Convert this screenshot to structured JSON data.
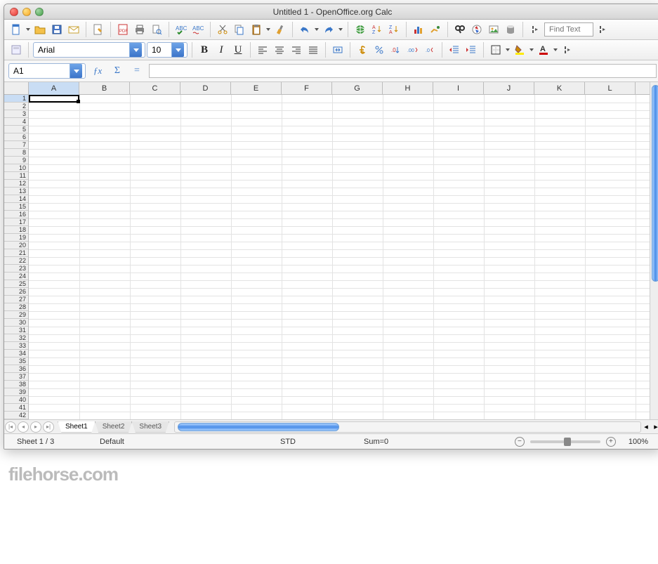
{
  "window": {
    "title": "Untitled 1 - OpenOffice.org Calc"
  },
  "toolbar1": {
    "icons": [
      "new-document",
      "open",
      "save",
      "mail",
      "edit-doc",
      "pdf-export",
      "print",
      "print-preview",
      "spellcheck",
      "auto-spellcheck",
      "cut",
      "copy",
      "paste",
      "format-paintbrush",
      "undo",
      "redo",
      "hyperlink",
      "sort-asc",
      "sort-desc",
      "insert-chart",
      "show-draw",
      "find-replace",
      "navigator",
      "gallery",
      "data-sources",
      "more"
    ],
    "find_placeholder": "Find Text"
  },
  "toolbar2": {
    "styles_icon": "styles",
    "font_name": "Arial",
    "font_size": "10",
    "bold": "B",
    "italic": "I",
    "underline": "U",
    "currency_icon": "currency",
    "percent_icon": "percent",
    "standard_icon": "standard",
    "add_dec": "add-decimal",
    "del_dec": "del-decimal",
    "dec_indent": "decrease-indent",
    "inc_indent": "increase-indent",
    "border": "borders",
    "bg": "background-color",
    "font_color": "font-color"
  },
  "formula": {
    "cell_ref": "A1",
    "fx_label": "ƒx",
    "sigma": "Σ",
    "equals": "=",
    "value": ""
  },
  "grid": {
    "columns": [
      "A",
      "B",
      "C",
      "D",
      "E",
      "F",
      "G",
      "H",
      "I",
      "J",
      "K",
      "L"
    ],
    "rows": [
      "1",
      "2",
      "3",
      "4",
      "5",
      "6",
      "7",
      "8",
      "9",
      "10",
      "11",
      "12",
      "13",
      "14",
      "15",
      "16",
      "17",
      "18",
      "19",
      "20",
      "21",
      "22",
      "23",
      "24",
      "25",
      "26",
      "27",
      "28",
      "29",
      "30",
      "31",
      "32",
      "33",
      "34",
      "35",
      "36",
      "37",
      "38",
      "39",
      "40",
      "41",
      "42"
    ],
    "selected_col": "A",
    "selected_row": "1"
  },
  "tabs": {
    "nav": [
      "first",
      "prev",
      "next",
      "last"
    ],
    "sheets": [
      "Sheet1",
      "Sheet2",
      "Sheet3"
    ],
    "active": 0
  },
  "status": {
    "sheet": "Sheet 1 / 3",
    "style": "Default",
    "mode": "STD",
    "sum": "Sum=0",
    "zoom": "100%"
  },
  "watermark": "filehorse.com"
}
